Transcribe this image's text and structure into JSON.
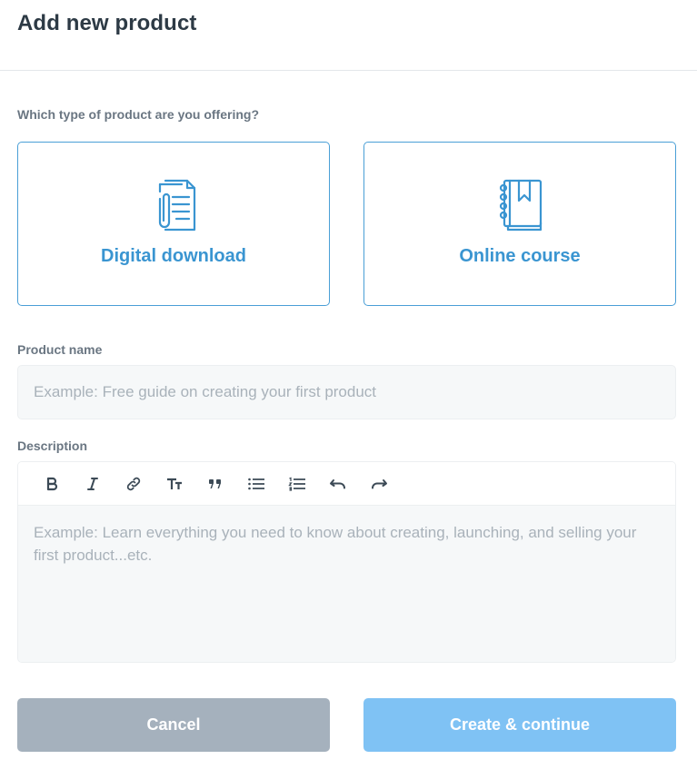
{
  "header": {
    "title": "Add new product"
  },
  "product_type": {
    "question": "Which type of product are you offering?",
    "options": [
      {
        "label": "Digital download",
        "icon": "document-paperclip-icon"
      },
      {
        "label": "Online course",
        "icon": "notebook-bookmark-icon"
      }
    ]
  },
  "product_name": {
    "label": "Product name",
    "placeholder": "Example: Free guide on creating your first product",
    "value": ""
  },
  "description": {
    "label": "Description",
    "toolbar": [
      "bold-icon",
      "italic-icon",
      "link-icon",
      "text-size-icon",
      "quote-icon",
      "bullet-list-icon",
      "numbered-list-icon",
      "undo-icon",
      "redo-icon"
    ],
    "placeholder": "Example: Learn everything you need to know about creating, launching, and selling your first product...etc."
  },
  "actions": {
    "cancel_label": "Cancel",
    "create_label": "Create & continue"
  },
  "colors": {
    "accent": "#3a95d1",
    "cancel_bg": "#a5b1bd",
    "create_bg": "#7fc2f4"
  }
}
